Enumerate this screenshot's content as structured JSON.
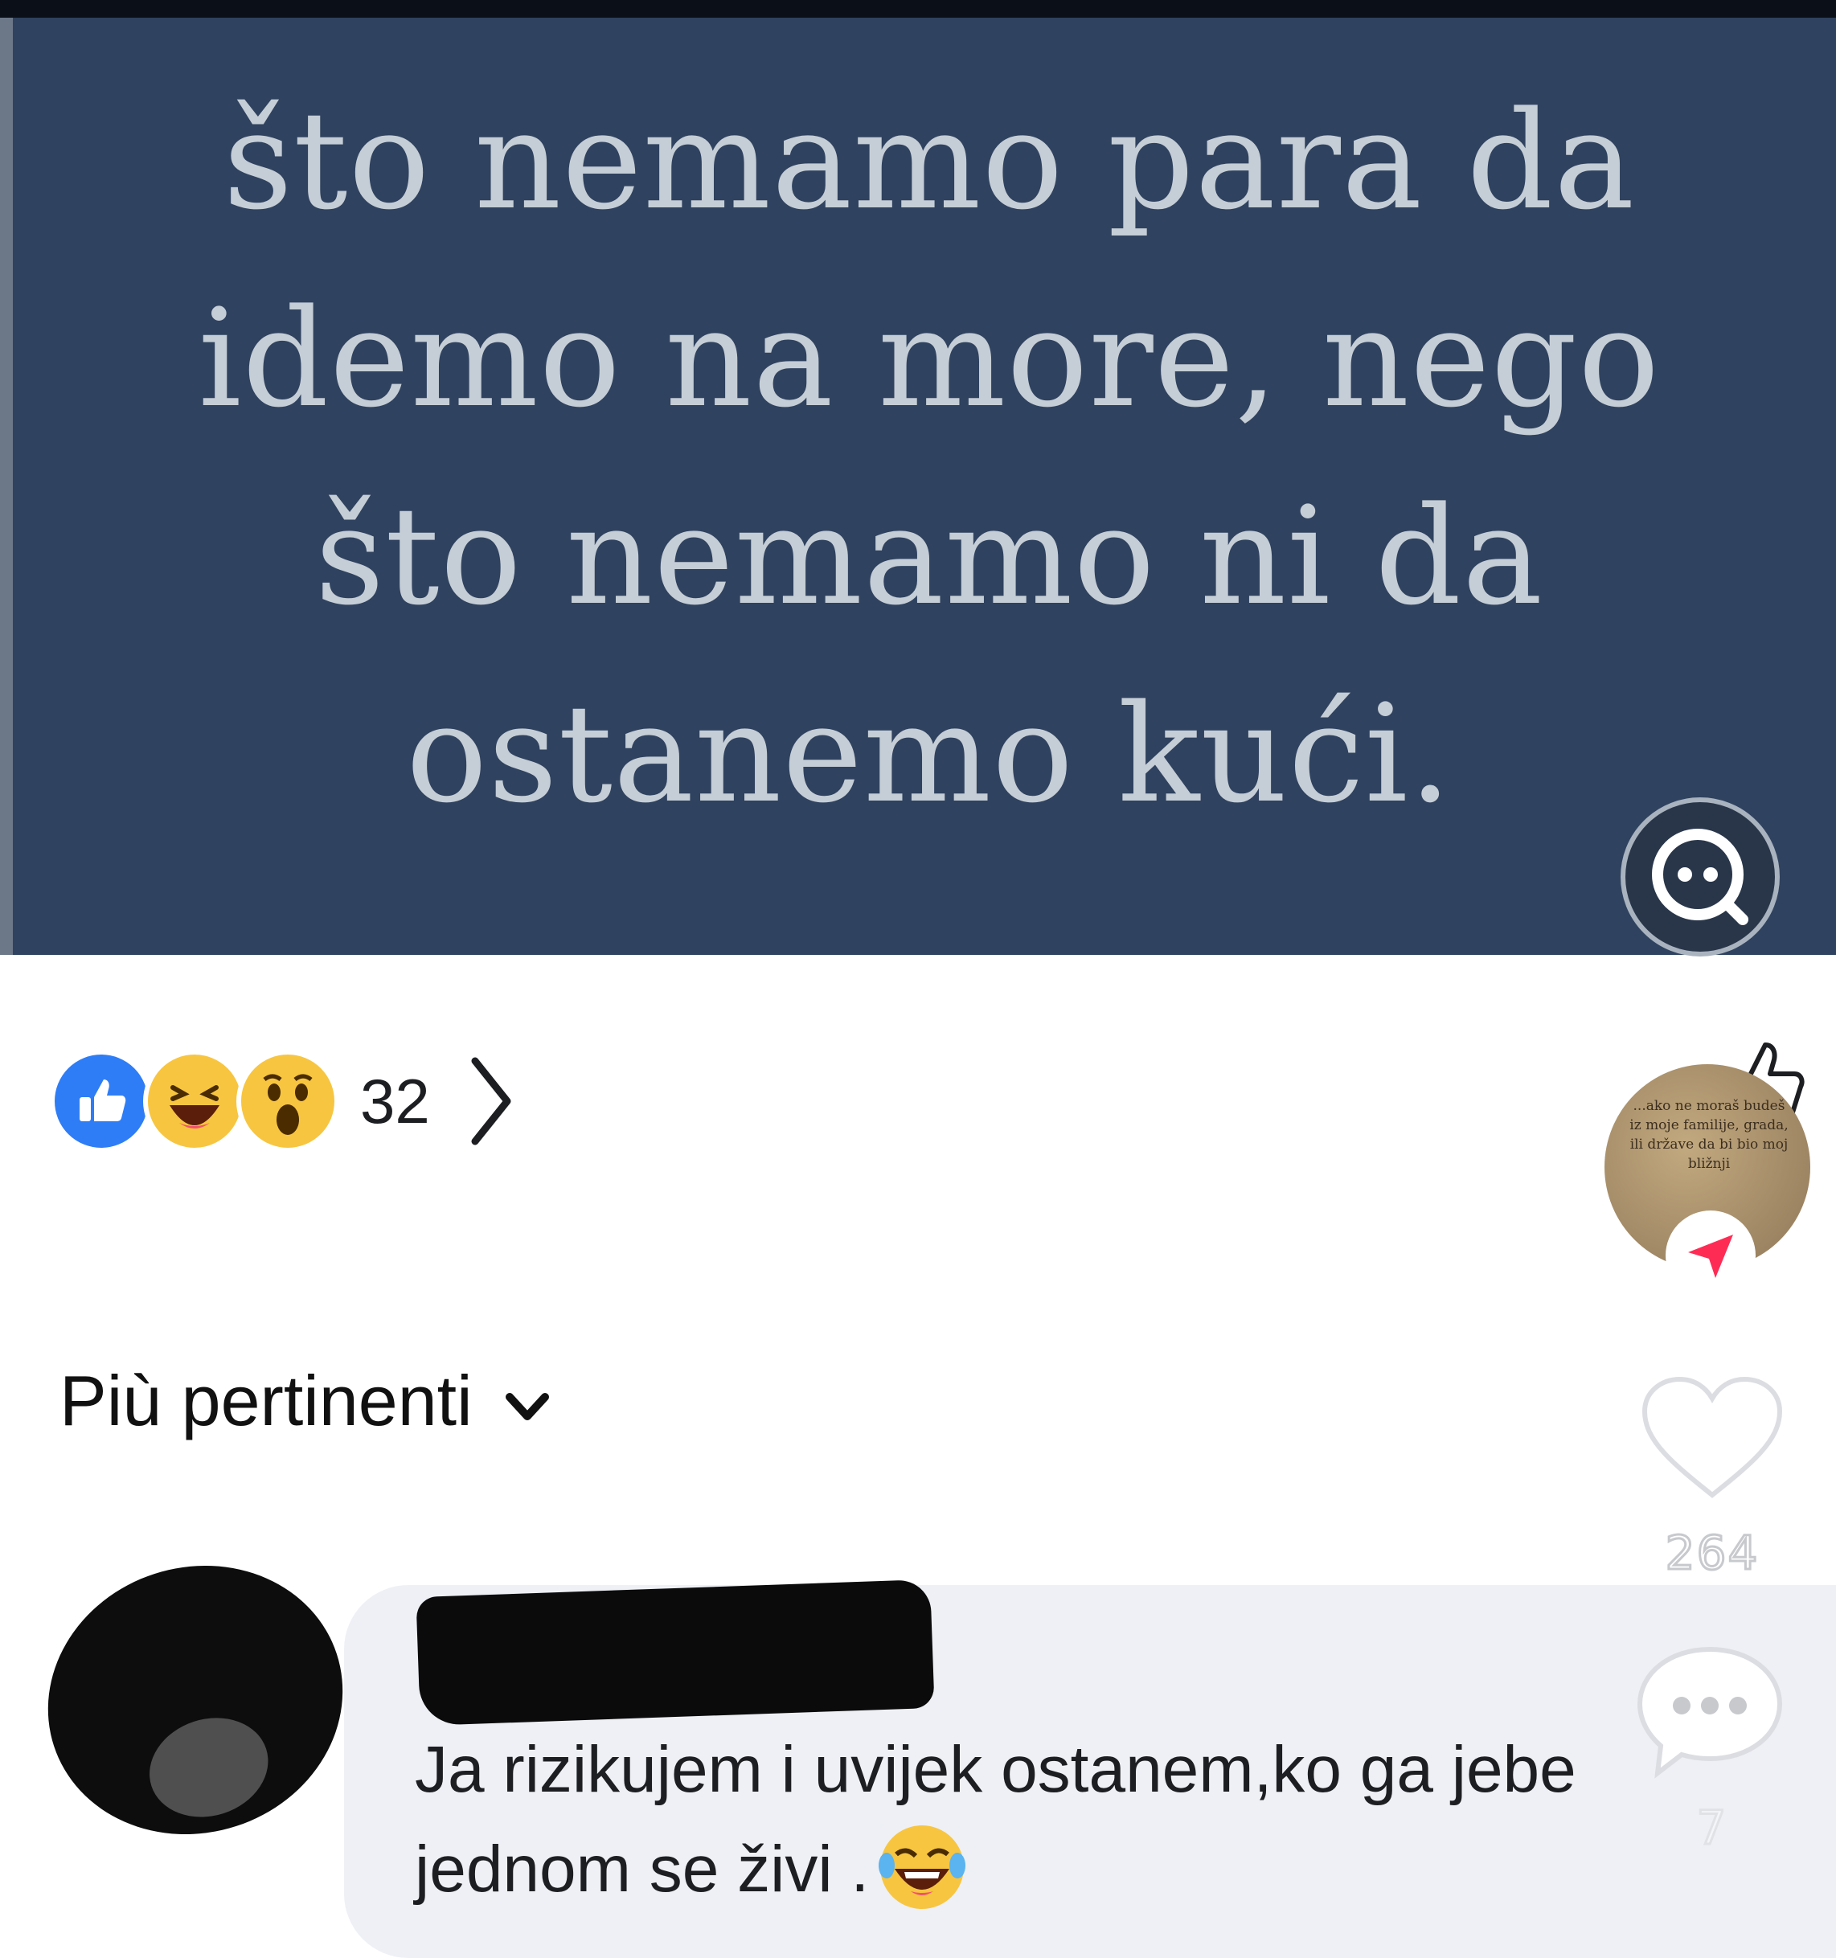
{
  "post": {
    "quote_lines": [
      "što nemamo para da",
      "idemo na more, nego",
      "što nemamo ni da",
      "ostanemo kući."
    ],
    "background_color": "#2f425f",
    "text_color": "#c5cdd6",
    "lens_icon": "lens-search-icon"
  },
  "reactions": {
    "icons": [
      "like-icon",
      "haha-icon",
      "wow-icon"
    ],
    "count": "32"
  },
  "comments": {
    "sort_label": "Più pertinenti",
    "items": [
      {
        "author": "",
        "text": "Ja rizikujem i uvijek ostanem,ko ga jebe jednom se živi .",
        "emoji": "tears-of-joy-emoji"
      }
    ]
  },
  "overlay": {
    "disc_text": "...ako ne moraš budeš iz moje familije, grada, ili države da bi bio moj bližnji",
    "like_count": "264",
    "comment_count": "7",
    "accent_color": "#fe2c55"
  }
}
